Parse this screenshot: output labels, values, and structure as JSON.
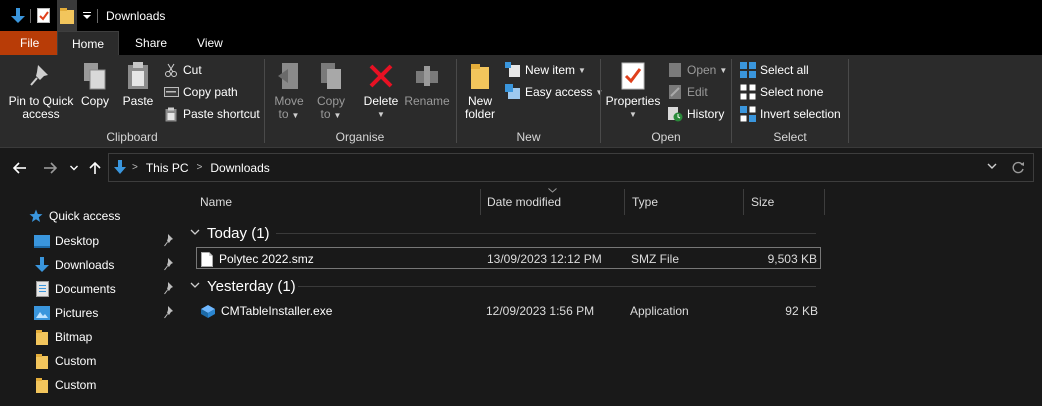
{
  "window": {
    "title": "Downloads"
  },
  "tabs": [
    "File",
    "Home",
    "Share",
    "View"
  ],
  "ribbon": {
    "clipboard": {
      "label": "Clipboard",
      "pin_line1": "Pin to Quick",
      "pin_line2": "access",
      "copy": "Copy",
      "paste": "Paste",
      "cut": "Cut",
      "copy_path": "Copy path",
      "paste_shortcut": "Paste shortcut"
    },
    "organise": {
      "label": "Organise",
      "move_to_line1": "Move",
      "move_to_line2": "to",
      "copy_to_line1": "Copy",
      "copy_to_line2": "to",
      "delete": "Delete",
      "rename": "Rename"
    },
    "new": {
      "label": "New",
      "new_folder_line1": "New",
      "new_folder_line2": "folder",
      "new_item": "New item",
      "easy_access": "Easy access"
    },
    "open": {
      "label": "Open",
      "properties": "Properties",
      "open": "Open",
      "edit": "Edit",
      "history": "History"
    },
    "select": {
      "label": "Select",
      "select_all": "Select all",
      "select_none": "Select none",
      "invert_selection": "Invert selection"
    }
  },
  "address": {
    "crumbs": [
      "This PC",
      "Downloads"
    ]
  },
  "navpane": {
    "items": [
      {
        "label": "Quick access",
        "icon": "star-icon",
        "pinned": false
      },
      {
        "label": "Desktop",
        "icon": "desktop-icon",
        "pinned": true
      },
      {
        "label": "Downloads",
        "icon": "download-icon",
        "pinned": true
      },
      {
        "label": "Documents",
        "icon": "documents-icon",
        "pinned": true
      },
      {
        "label": "Pictures",
        "icon": "pictures-icon",
        "pinned": true
      },
      {
        "label": "Bitmap",
        "icon": "folder-icon",
        "pinned": false
      },
      {
        "label": "Custom",
        "icon": "folder-icon",
        "pinned": false
      },
      {
        "label": "Custom",
        "icon": "folder-icon",
        "pinned": false
      }
    ]
  },
  "columns": {
    "name": "Name",
    "date": "Date modified",
    "type": "Type",
    "size": "Size"
  },
  "groups": [
    {
      "title": "Today (1)",
      "files": [
        {
          "name": "Polytec 2022.smz",
          "date": "13/09/2023 12:12 PM",
          "type": "SMZ File",
          "size": "9,503 KB",
          "icon": "file-icon",
          "selected": true
        }
      ]
    },
    {
      "title": "Yesterday (1)",
      "files": [
        {
          "name": "CMTableInstaller.exe",
          "date": "12/09/2023 1:56 PM",
          "type": "Application",
          "size": "92 KB",
          "icon": "installer-icon",
          "selected": false
        }
      ]
    }
  ],
  "colors": {
    "file_tab": "#b83c07",
    "accent_blue": "#3a96dd",
    "folder": "#f2c55c",
    "delete_red": "#e81123"
  }
}
